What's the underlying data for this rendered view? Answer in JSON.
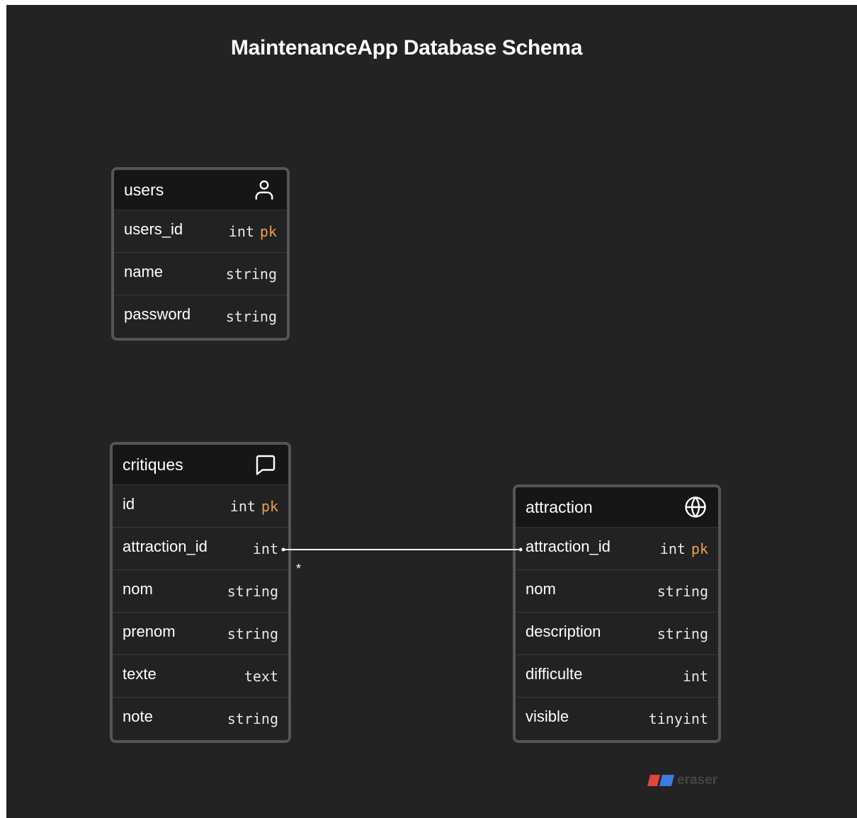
{
  "title": "MaintenanceApp Database Schema",
  "tables": {
    "users": {
      "name": "users",
      "icon": "user-icon",
      "fields": [
        {
          "name": "users_id",
          "type": "int",
          "key": "pk"
        },
        {
          "name": "name",
          "type": "string",
          "key": ""
        },
        {
          "name": "password",
          "type": "string",
          "key": ""
        }
      ]
    },
    "critiques": {
      "name": "critiques",
      "icon": "message-square-icon",
      "fields": [
        {
          "name": "id",
          "type": "int",
          "key": "pk"
        },
        {
          "name": "attraction_id",
          "type": "int",
          "key": ""
        },
        {
          "name": "nom",
          "type": "string",
          "key": ""
        },
        {
          "name": "prenom",
          "type": "string",
          "key": ""
        },
        {
          "name": "texte",
          "type": "text",
          "key": ""
        },
        {
          "name": "note",
          "type": "string",
          "key": ""
        }
      ]
    },
    "attraction": {
      "name": "attraction",
      "icon": "globe-icon",
      "fields": [
        {
          "name": "attraction_id",
          "type": "int",
          "key": "pk"
        },
        {
          "name": "nom",
          "type": "string",
          "key": ""
        },
        {
          "name": "description",
          "type": "string",
          "key": ""
        },
        {
          "name": "difficulte",
          "type": "int",
          "key": ""
        },
        {
          "name": "visible",
          "type": "tinyint",
          "key": ""
        }
      ]
    }
  },
  "relationship": {
    "from": "critiques.attraction_id",
    "to": "attraction.attraction_id",
    "cardinality_marker": "*"
  },
  "branding": {
    "logo_text": "eraser",
    "colors": {
      "left": "#e2443e",
      "right": "#3c7be0"
    }
  },
  "colors": {
    "background": "#232323",
    "key_accent": "#f0a04b"
  }
}
